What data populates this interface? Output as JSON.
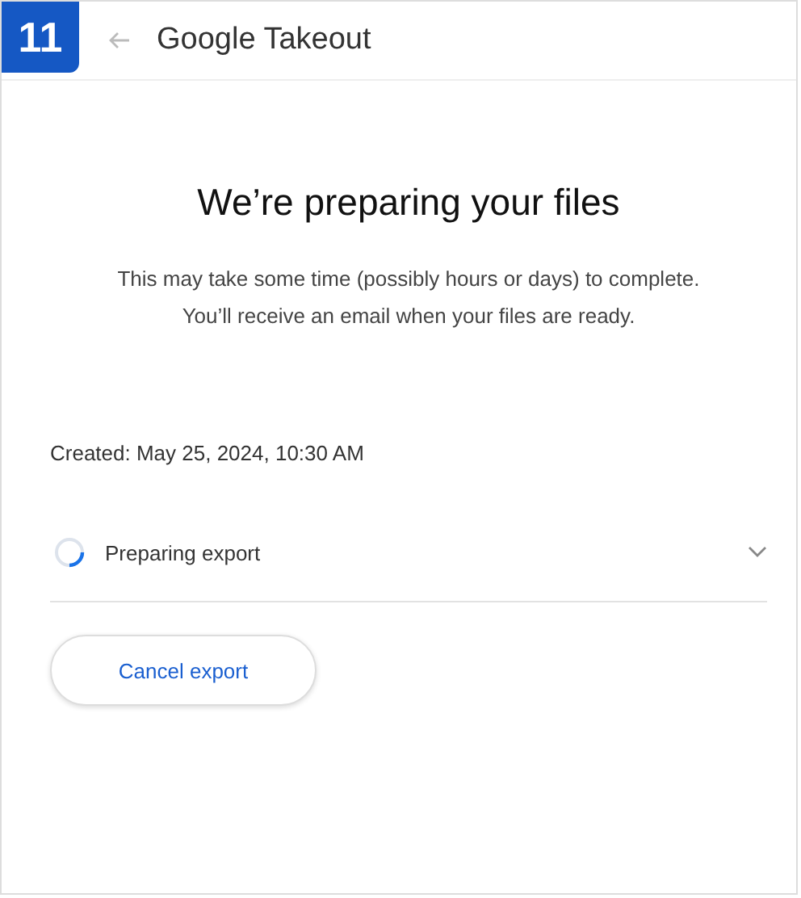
{
  "badge": "11",
  "header": {
    "title": "Google Takeout"
  },
  "heading": "We’re preparing your files",
  "description": [
    "This may take some time (possibly hours or days) to complete.",
    "You’ll receive an email when your files are ready."
  ],
  "created": "Created: May 25, 2024, 10:30 AM",
  "export": {
    "label": "Preparing export",
    "expanded": false
  },
  "buttons": [
    {
      "label": "Cancel export"
    }
  ]
}
